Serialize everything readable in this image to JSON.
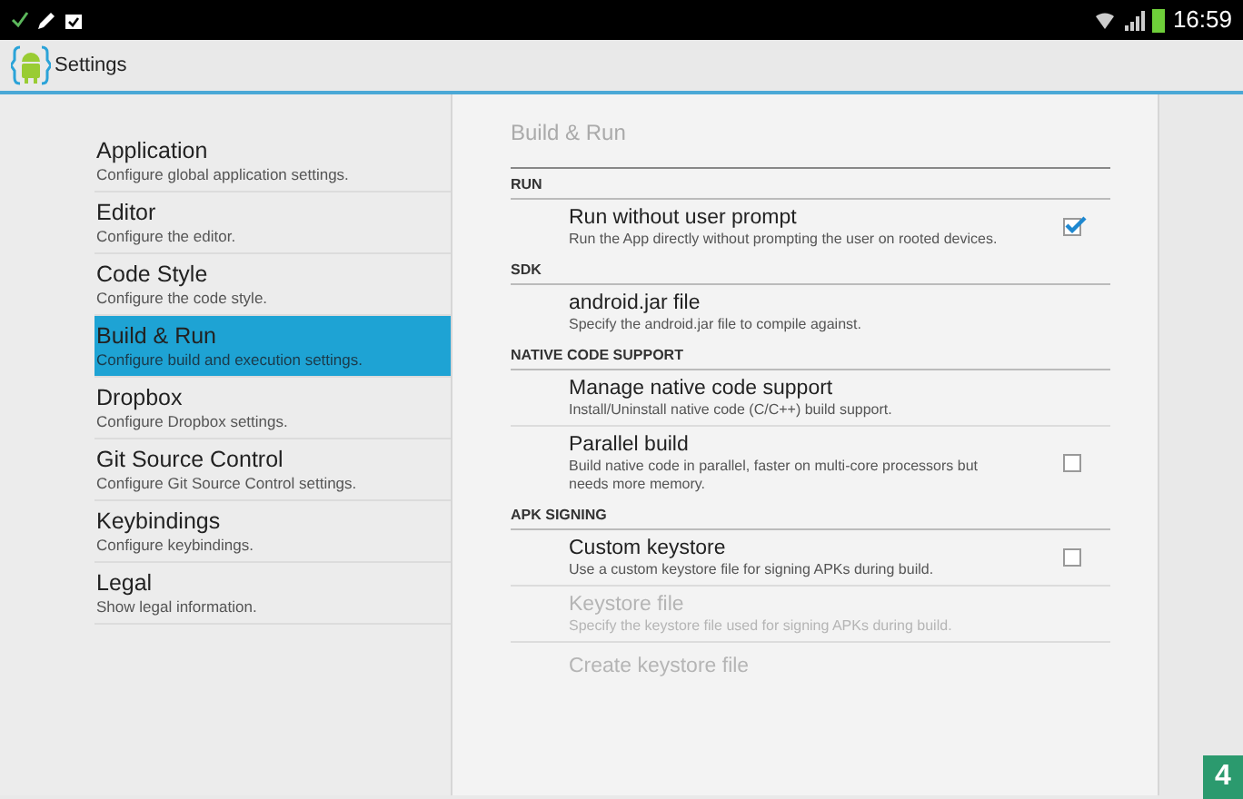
{
  "status_bar": {
    "time": "16:59"
  },
  "action_bar": {
    "title": "Settings"
  },
  "categories": [
    {
      "title": "Application",
      "summary": "Configure global application settings.",
      "selected": false
    },
    {
      "title": "Editor",
      "summary": "Configure the editor.",
      "selected": false
    },
    {
      "title": "Code Style",
      "summary": "Configure the code style.",
      "selected": false
    },
    {
      "title": "Build & Run",
      "summary": "Configure build and execution settings.",
      "selected": true
    },
    {
      "title": "Dropbox",
      "summary": "Configure Dropbox settings.",
      "selected": false
    },
    {
      "title": "Git Source Control",
      "summary": "Configure Git Source Control settings.",
      "selected": false
    },
    {
      "title": "Keybindings",
      "summary": "Configure keybindings.",
      "selected": false
    },
    {
      "title": "Legal",
      "summary": "Show legal information.",
      "selected": false
    }
  ],
  "detail": {
    "title": "Build & Run",
    "sections": [
      {
        "header": "RUN",
        "items": [
          {
            "kind": "checkbox",
            "title": "Run without user prompt",
            "summary": "Run the App directly without prompting the user on rooted devices.",
            "checked": true,
            "disabled": false
          }
        ]
      },
      {
        "header": "SDK",
        "items": [
          {
            "kind": "plain",
            "title": "android.jar file",
            "summary": "Specify the android.jar file to compile against.",
            "disabled": false
          }
        ]
      },
      {
        "header": "NATIVE CODE SUPPORT",
        "items": [
          {
            "kind": "plain",
            "title": "Manage native code support",
            "summary": "Install/Uninstall native code (C/C++) build support.",
            "disabled": false
          },
          {
            "kind": "checkbox",
            "title": "Parallel build",
            "summary": "Build native code in parallel, faster on multi-core processors but needs more memory.",
            "checked": false,
            "disabled": false
          }
        ]
      },
      {
        "header": "APK SIGNING",
        "items": [
          {
            "kind": "checkbox",
            "title": "Custom keystore",
            "summary": "Use a custom keystore file for signing APKs during build.",
            "checked": false,
            "disabled": false
          },
          {
            "kind": "plain",
            "title": "Keystore file",
            "summary": "Specify the keystore file used for signing APKs during build.",
            "disabled": true
          },
          {
            "kind": "plain",
            "title": "Create keystore file",
            "disabled": true
          }
        ]
      }
    ]
  },
  "callout_number": "4"
}
